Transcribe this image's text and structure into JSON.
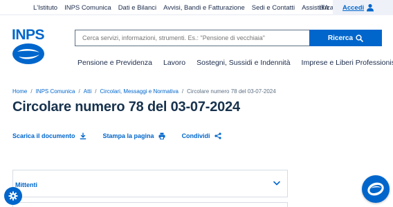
{
  "topbar": {
    "links": [
      "L'Istituto",
      "INPS Comunica",
      "Dati e Bilanci",
      "Avvisi, Bandi e Fatturazione",
      "Sedi e Contatti",
      "Assistenza"
    ],
    "language": "ITA",
    "login_label": "Accedi"
  },
  "header": {
    "logo_text": "INPS",
    "search_placeholder": "Cerca servizi, informazioni, strumenti. Es.: \"Pensione di vecchiaia\"",
    "search_button": "Ricerca"
  },
  "mainnav": {
    "items": [
      "Pensione e Previdenza",
      "Lavoro",
      "Sostegni, Sussidi e Indennità",
      "Imprese e Liberi Professionisti"
    ]
  },
  "breadcrumb": {
    "items": [
      "Home",
      "INPS Comunica",
      "Atti",
      "Circolari, Messaggi e Normativa"
    ],
    "current": "Circolare numero 78 del 03-07-2024"
  },
  "page": {
    "title": "Circolare numero 78 del 03-07-2024"
  },
  "actions": {
    "download": "Scarica il documento",
    "print": "Stampa la pagina",
    "share": "Condividi"
  },
  "accordion": {
    "title": "Mittenti"
  },
  "colors": {
    "primary": "#0066cc",
    "title": "#17324d",
    "text": "#1a2a4a",
    "muted": "#5c6f82"
  },
  "icons": [
    "user-icon",
    "search-icon",
    "download-icon",
    "print-icon",
    "share-icon",
    "chevron-down-icon",
    "gear-icon",
    "chat-icon"
  ]
}
